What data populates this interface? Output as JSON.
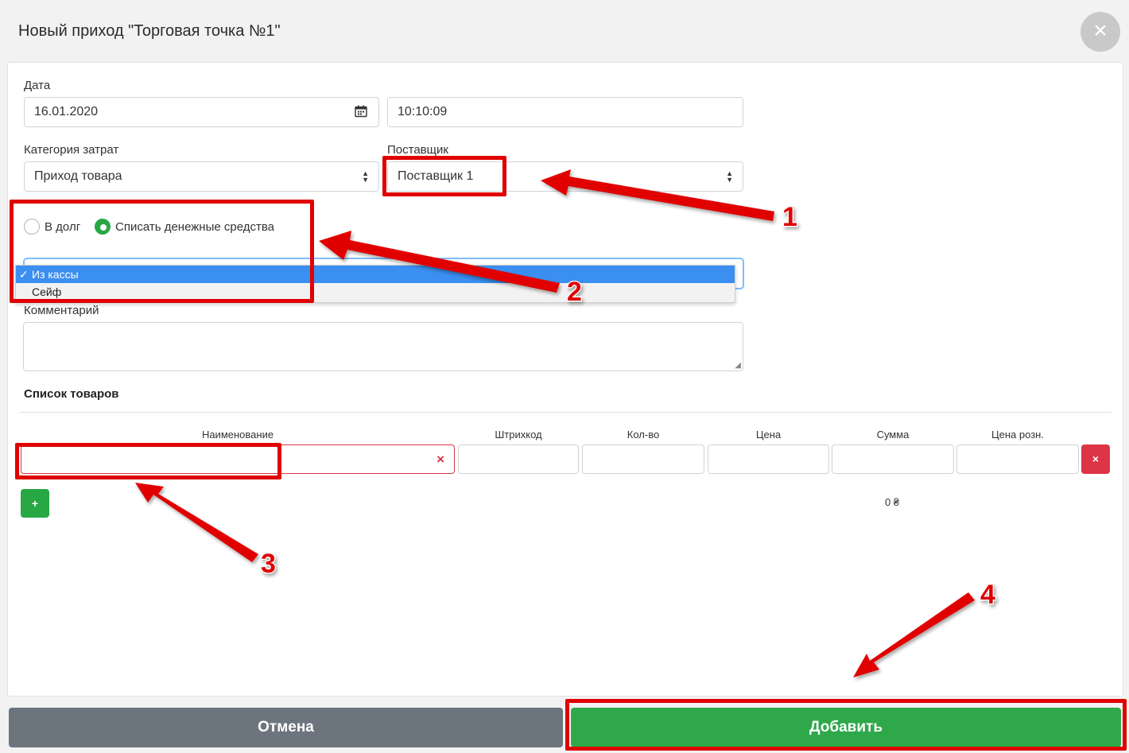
{
  "modal": {
    "title": "Новый приход \"Торговая точка №1\"",
    "close_glyph": "×"
  },
  "form": {
    "date_label": "Дата",
    "date_value": "16.01.2020",
    "time_value": "10:10:09",
    "category_label": "Категория затрат",
    "category_value": "Приход товара",
    "supplier_label": "Поставщик",
    "supplier_value": "Поставщик 1",
    "payment_options": [
      {
        "label": "В долг",
        "checked": false
      },
      {
        "label": "Списать денежные средства",
        "checked": true
      }
    ],
    "source_options": [
      {
        "label": "Из кассы",
        "selected": true
      },
      {
        "label": "Сейф",
        "selected": false
      }
    ],
    "comment_label": "Комментарий",
    "comment_value": ""
  },
  "products": {
    "section_title": "Список товаров",
    "columns": [
      "Наименование",
      "Штрихкод",
      "Кол-во",
      "Цена",
      "Сумма",
      "Цена розн."
    ],
    "add_glyph": "+",
    "delete_glyph": "×",
    "total": "0 ₴"
  },
  "footer": {
    "cancel_label": "Отмена",
    "submit_label": "Добавить"
  },
  "annotations": {
    "markers": [
      "1",
      "2",
      "3",
      "4"
    ],
    "color": "#e00000"
  },
  "icons": [
    "close-icon",
    "calendar-icon",
    "select-arrows-icon",
    "check-icon",
    "clear-icon",
    "resize-grip-icon"
  ]
}
